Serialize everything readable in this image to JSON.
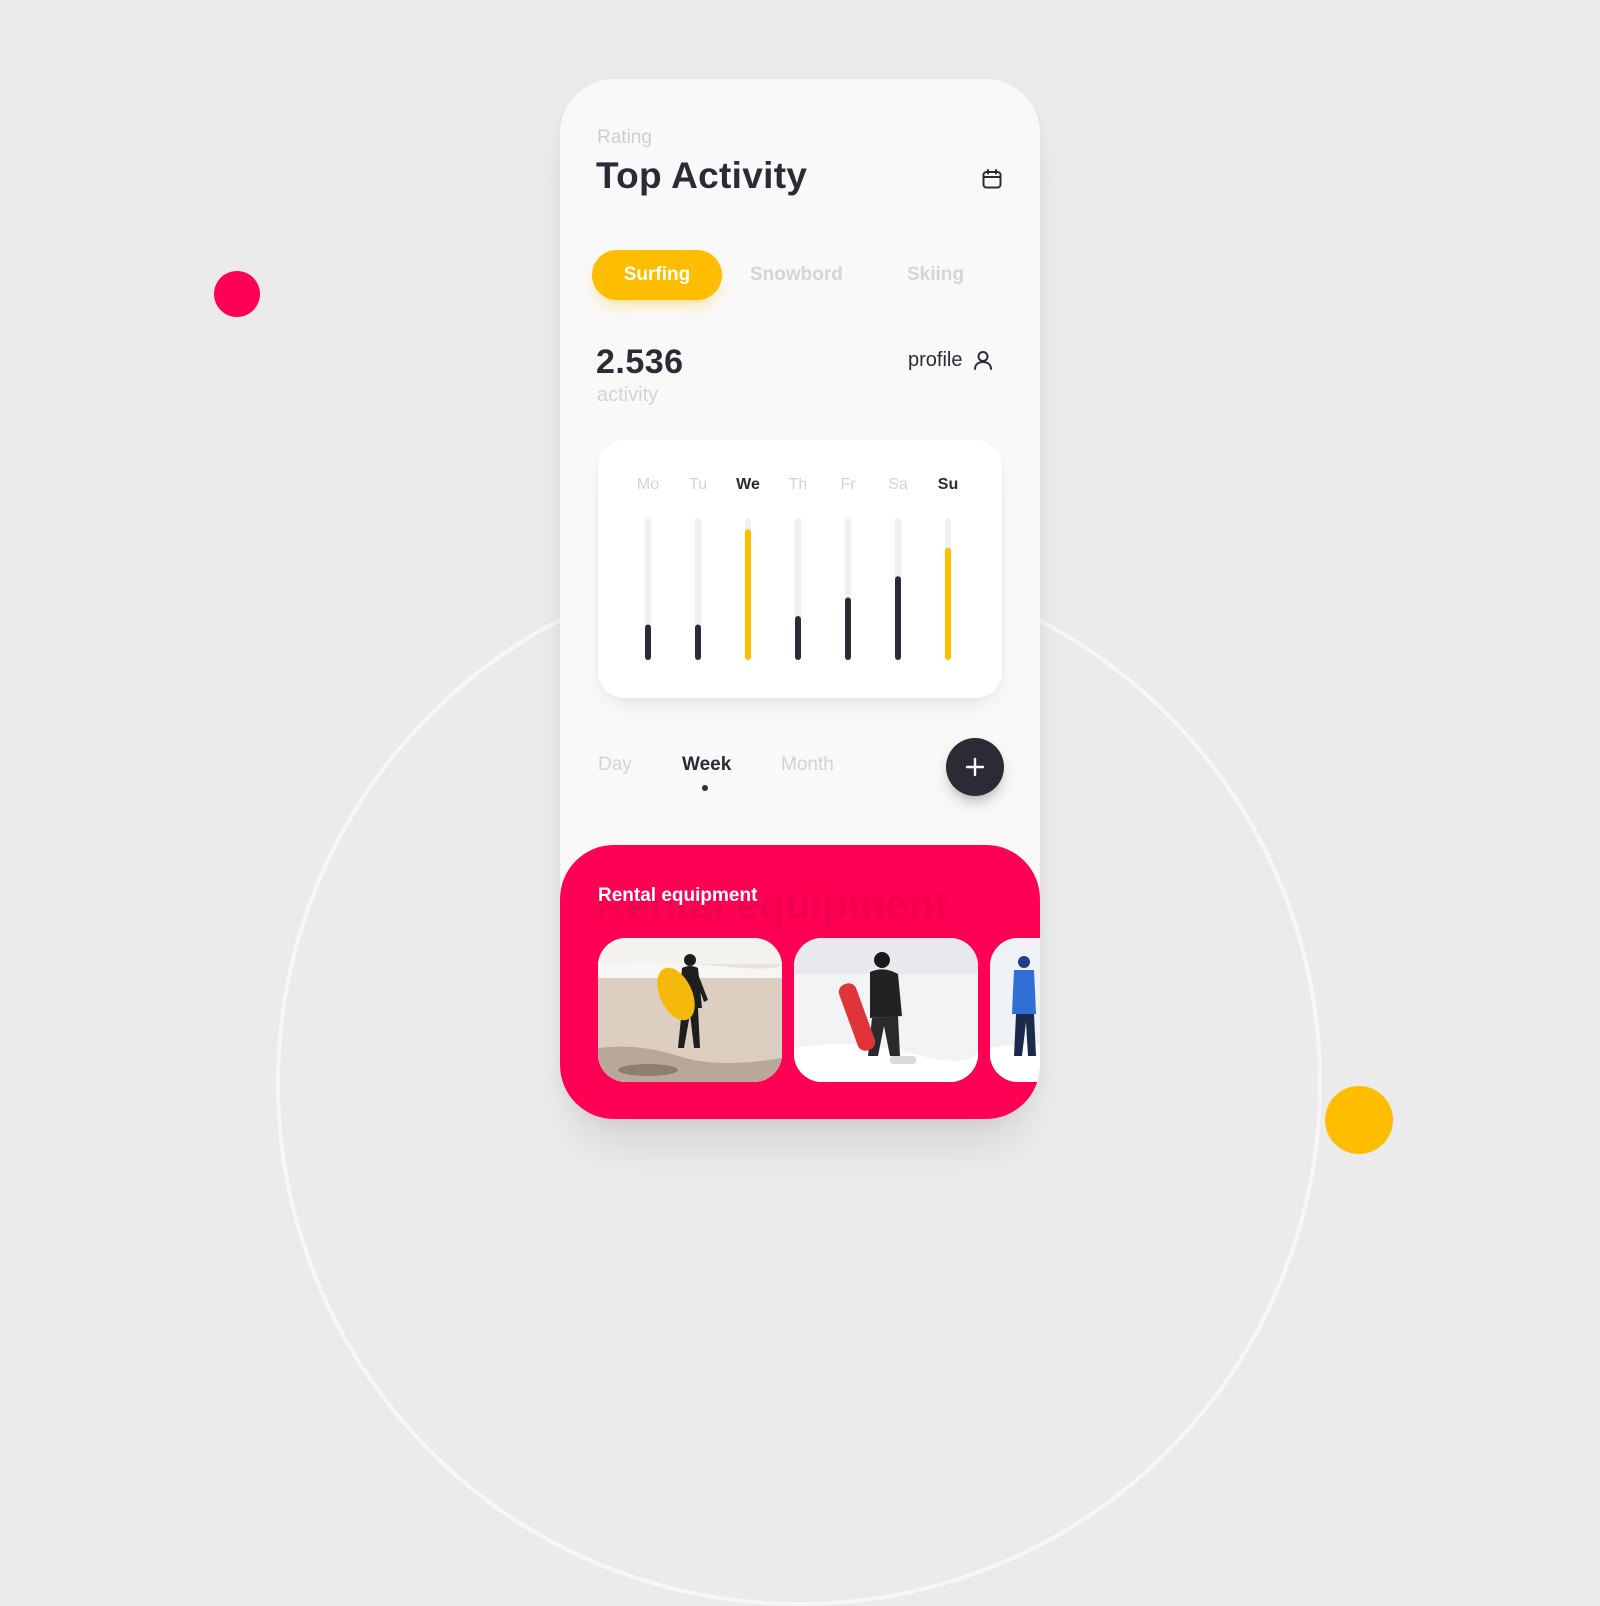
{
  "header": {
    "eyebrow": "Rating",
    "title": "Top Activity",
    "calendar_icon": "calendar-icon"
  },
  "activity_tabs": [
    {
      "label": "Surfing",
      "active": true
    },
    {
      "label": "Snowbord",
      "active": false
    },
    {
      "label": "Skiing",
      "active": false
    }
  ],
  "stats": {
    "value": "2.536",
    "label": "activity"
  },
  "profile": {
    "label": "profile",
    "icon": "user-icon"
  },
  "chart_data": {
    "type": "bar",
    "categories": [
      "Mo",
      "Tu",
      "We",
      "Th",
      "Fr",
      "Sa",
      "Su"
    ],
    "values": [
      0.25,
      0.25,
      0.92,
      0.31,
      0.44,
      0.59,
      0.79
    ],
    "highlighted": [
      "We",
      "Su"
    ],
    "ylim": [
      0,
      1
    ],
    "colors": {
      "highlight": "#ffbd00",
      "default": "#2b2b36",
      "track": "#f0f0f0",
      "label_active": "#2b2b36",
      "label": "#d3d3d3"
    }
  },
  "period_tabs": [
    {
      "label": "Day",
      "active": false
    },
    {
      "label": "Week",
      "active": true
    },
    {
      "label": "Month",
      "active": false
    }
  ],
  "add_button": {
    "icon": "plus-icon"
  },
  "rental": {
    "title": "Rental equipment",
    "ghost_title": "Rental equipment",
    "items": [
      {
        "image": "surfer-beach-photo"
      },
      {
        "image": "snowboarder-snow-photo"
      },
      {
        "image": "skier-photo"
      }
    ]
  },
  "colors": {
    "accent_yellow": "#ffbd00",
    "accent_red": "#ff0055",
    "dark": "#2b2b36",
    "background": "#ebebeb"
  }
}
